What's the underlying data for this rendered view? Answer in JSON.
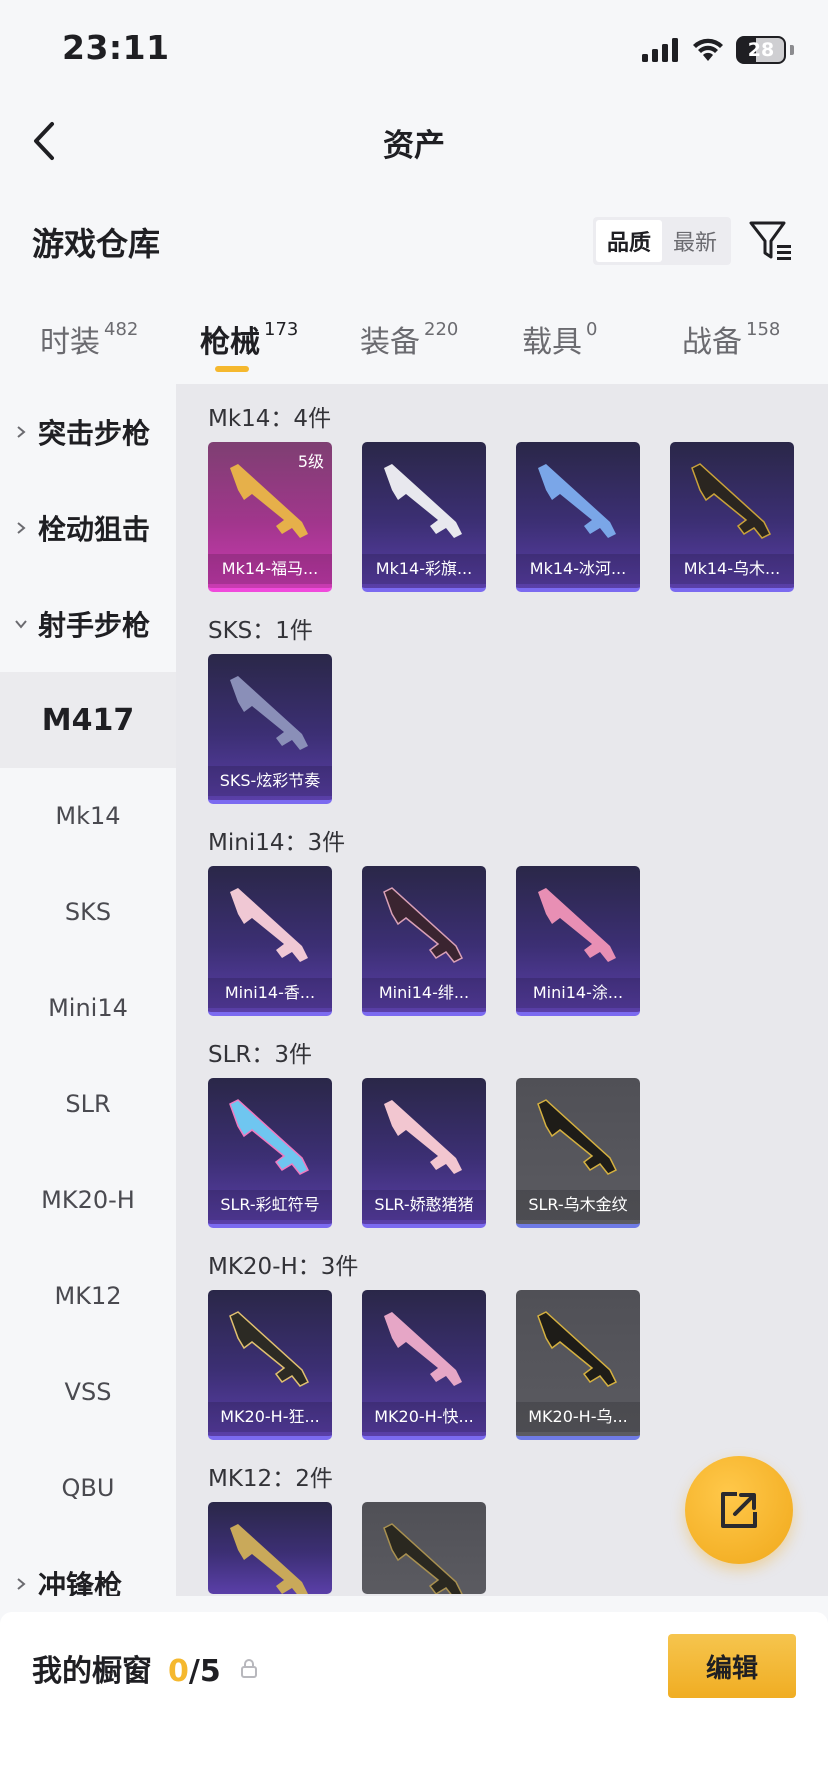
{
  "status_bar": {
    "time": "23:11",
    "battery": "28"
  },
  "nav": {
    "title": "资产"
  },
  "warehouse": {
    "title": "游戏仓库",
    "sort": [
      "品质",
      "最新"
    ]
  },
  "tabs": [
    {
      "label": "时装",
      "count": "482"
    },
    {
      "label": "枪械",
      "count": "173"
    },
    {
      "label": "装备",
      "count": "220"
    },
    {
      "label": "载具",
      "count": "0"
    },
    {
      "label": "战备",
      "count": "158"
    }
  ],
  "sidebar": {
    "groups": [
      "突击步枪",
      "栓动狙击",
      "射手步枪",
      "冲锋枪"
    ],
    "subs": [
      "M417",
      "Mk14",
      "SKS",
      "Mini14",
      "SLR",
      "MK20-H",
      "MK12",
      "VSS",
      "QBU"
    ]
  },
  "sections": [
    {
      "title": "Mk14：4件",
      "items": [
        "Mk14-福马...",
        "Mk14-彩旗...",
        "Mk14-冰河...",
        "Mk14-乌木..."
      ],
      "level": "5级"
    },
    {
      "title": "SKS：1件",
      "items": [
        "SKS-炫彩节奏"
      ]
    },
    {
      "title": "Mini14：3件",
      "items": [
        "Mini14-香...",
        "Mini14-绯...",
        "Mini14-涂..."
      ]
    },
    {
      "title": "SLR：3件",
      "items": [
        "SLR-彩虹符号",
        "SLR-娇憨猪猪",
        "SLR-乌木金纹"
      ]
    },
    {
      "title": "MK20-H：3件",
      "items": [
        "MK20-H-狂...",
        "MK20-H-快...",
        "MK20-H-乌..."
      ]
    },
    {
      "title": "MK12：2件"
    }
  ],
  "bottom": {
    "label": "我的橱窗",
    "count": "0",
    "sep": "/",
    "total": "5",
    "edit": "编辑"
  },
  "colors": {
    "accent": "#f5b82e",
    "card_purple": "#3c2f74",
    "card_pink": "#c93bb1",
    "card_gray": "#5b5b61"
  },
  "icons": [
    "back-arrow-icon",
    "filter-icon",
    "chevron-right-icon",
    "chevron-down-icon",
    "share-icon",
    "lock-icon",
    "signal-icon",
    "wifi-icon",
    "battery-icon"
  ]
}
